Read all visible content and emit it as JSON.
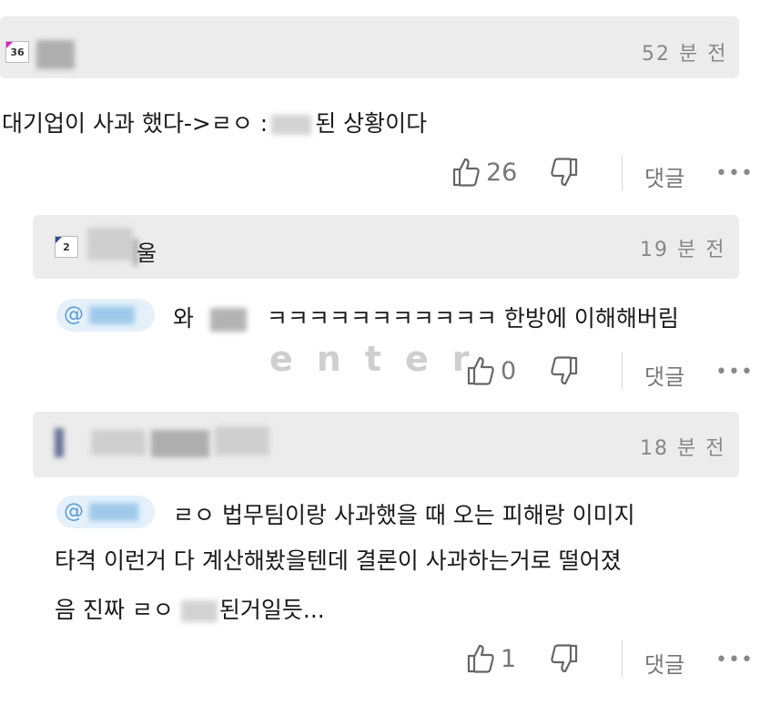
{
  "comments": [
    {
      "level": "36",
      "time": "52 분 전",
      "text": "대기업이 사과 했다->ㄹㅇ :",
      "text_tail": "된 상황이다",
      "likes": "26",
      "reply": "댓글",
      "more": "•••"
    },
    {
      "level": "2",
      "name_suffix": "울",
      "time": "19 분 전",
      "mention": "@",
      "text_lead": "와",
      "text": "ㅋㅋㅋㅋㅋㅋㅋㅋㅋㅋㅋ 한방에 이해해버림",
      "likes": "0",
      "reply": "댓글",
      "more": "•••"
    },
    {
      "time": "18 분 전",
      "mention": "@",
      "line1": "ㄹㅇ 법무팀이랑 사과했을 때 오는 피해랑 이미지",
      "line2": "타격 이런거 다 계산해봤을텐데 결론이 사과하는거로 떨어졌",
      "line3_a": "음 진짜 ㄹㅇ",
      "line3_b": "된거일듯...",
      "likes": "1",
      "reply": "댓글",
      "more": "•••"
    }
  ],
  "watermark": "enter",
  "icons": [
    "thumbs-up-icon",
    "thumbs-down-icon",
    "more-icon"
  ],
  "colors": {
    "header_bg": "#ececec",
    "mention_bg": "#e4f1fb",
    "mention_text": "#5a9bd3",
    "badge_accent": "#e020c0"
  }
}
